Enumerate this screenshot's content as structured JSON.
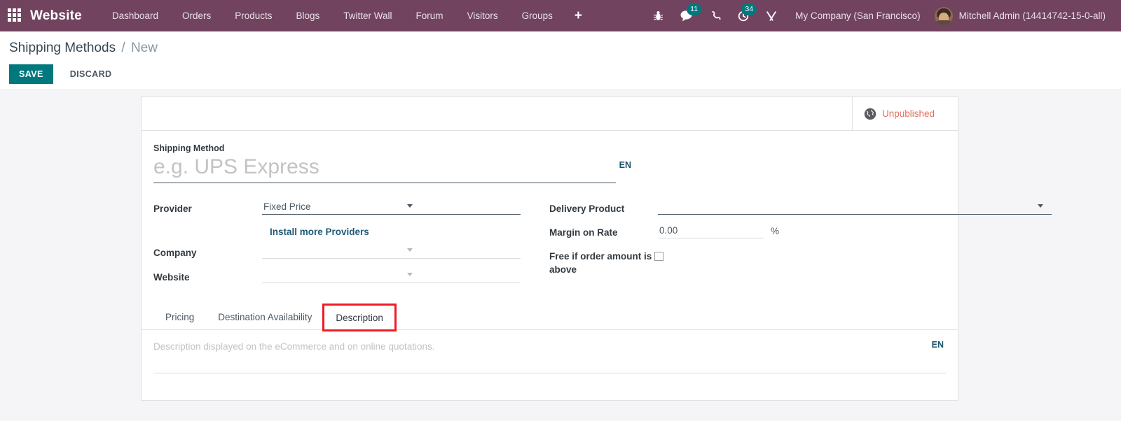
{
  "navbar": {
    "apps_icon": "apps-grid-icon",
    "brand": "Website",
    "menu": [
      {
        "label": "Dashboard"
      },
      {
        "label": "Orders"
      },
      {
        "label": "Products"
      },
      {
        "label": "Blogs"
      },
      {
        "label": "Twitter Wall"
      },
      {
        "label": "Forum"
      },
      {
        "label": "Visitors"
      },
      {
        "label": "Groups"
      }
    ],
    "plus_label": "+",
    "sys_icons": [
      {
        "name": "bug-icon",
        "badge": null
      },
      {
        "name": "messages-icon",
        "badge": "11"
      },
      {
        "name": "phone-icon",
        "badge": null
      },
      {
        "name": "activities-clock-icon",
        "badge": "34"
      },
      {
        "name": "tools-wrench-icon",
        "badge": null
      }
    ],
    "company": "My Company (San Francisco)",
    "user": "Mitchell Admin (14414742-15-0-all)",
    "bg_color": "#71435f",
    "badge_color": "#00787e"
  },
  "control_panel": {
    "breadcrumb_root": "Shipping Methods",
    "breadcrumb_sep": "/",
    "breadcrumb_current": "New",
    "save_label": "SAVE",
    "discard_label": "DISCARD",
    "save_color": "#00787e"
  },
  "sheet": {
    "status": {
      "icon": "globe-icon",
      "label": "Unpublished",
      "color": "#e2715f"
    },
    "title_field": {
      "label": "Shipping Method",
      "value": "",
      "placeholder": "e.g. UPS Express",
      "lang_tag": "EN"
    },
    "left_column": [
      {
        "label": "Provider",
        "type": "select",
        "value": "Fixed Price",
        "options": [
          "Fixed Price"
        ]
      },
      {
        "label": "Company",
        "type": "select",
        "value": "",
        "options": []
      },
      {
        "label": "Website",
        "type": "select",
        "value": "",
        "options": []
      }
    ],
    "install_link": "Install more Providers",
    "right_column": [
      {
        "label": "Delivery Product",
        "type": "select",
        "value": "",
        "options": []
      },
      {
        "label": "Margin on Rate",
        "type": "number",
        "value": "0.00",
        "suffix": "%"
      },
      {
        "label": "Free if order amount is above",
        "type": "checkbox",
        "checked": false
      }
    ],
    "tabs": [
      {
        "label": "Pricing",
        "active": false,
        "highlighted": false
      },
      {
        "label": "Destination Availability",
        "active": false,
        "highlighted": false
      },
      {
        "label": "Description",
        "active": true,
        "highlighted": true
      }
    ],
    "highlight_color": "#ee1c25",
    "description_panel": {
      "placeholder": "Description displayed on the eCommerce and on online quotations.",
      "value": "",
      "lang_tag": "EN"
    }
  }
}
